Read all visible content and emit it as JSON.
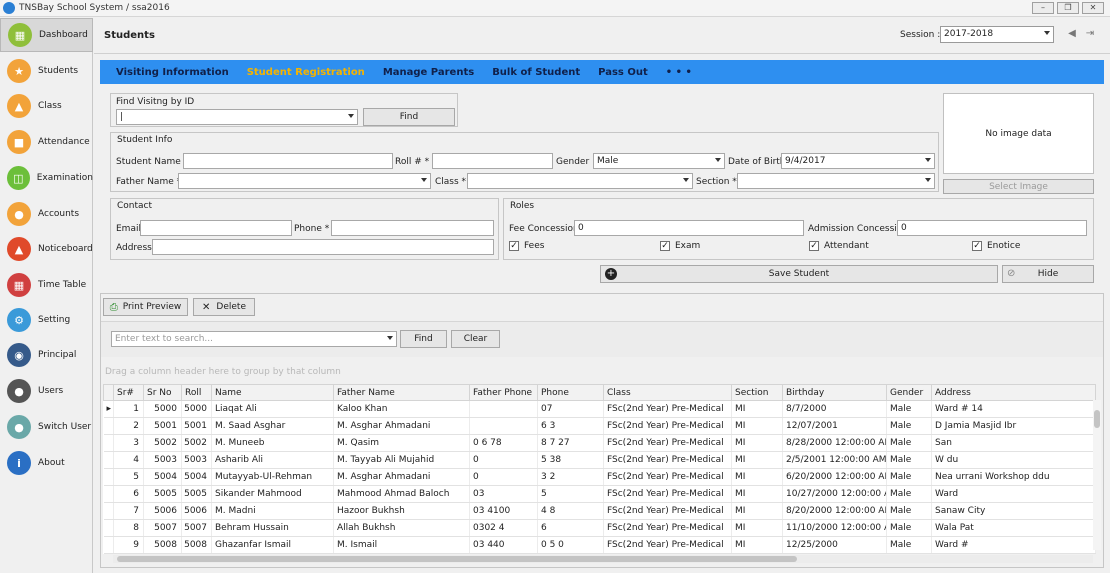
{
  "window": {
    "title": "TNSBay School System / ssa2016"
  },
  "sidebar": {
    "items": [
      {
        "label": "Dashboard",
        "icon": "dashboard-icon",
        "color": "#8fbf3a"
      },
      {
        "label": "Students",
        "icon": "graduate-icon",
        "color": "#f2a33a"
      },
      {
        "label": "Class",
        "icon": "class-icon",
        "color": "#f2a33a"
      },
      {
        "label": "Attendance",
        "icon": "attendance-icon",
        "color": "#f2a33a"
      },
      {
        "label": "Examination",
        "icon": "examination-icon",
        "color": "#6cbf3a"
      },
      {
        "label": "Accounts",
        "icon": "accounts-icon",
        "color": "#f2a33a"
      },
      {
        "label": "Noticeboard",
        "icon": "bell-icon",
        "color": "#e04a2a"
      },
      {
        "label": "Time Table",
        "icon": "calendar-icon",
        "color": "#d04040"
      },
      {
        "label": "Setting",
        "icon": "gear-icon",
        "color": "#3a9ad9"
      },
      {
        "label": "Principal",
        "icon": "eye-icon",
        "color": "#355a8a"
      },
      {
        "label": "Users",
        "icon": "user-icon",
        "color": "#555555"
      },
      {
        "label": "Switch User",
        "icon": "switch-user-icon",
        "color": "#6aa8a8"
      },
      {
        "label": "About",
        "icon": "info-icon",
        "color": "#2a6fc4"
      }
    ]
  },
  "header": {
    "title": "Students",
    "session_label": "Session :",
    "session_value": "2017-2018"
  },
  "nav": {
    "items": [
      "Visiting Information",
      "Student Registration",
      "Manage Parents",
      "Bulk of Student",
      "Pass Out",
      "• • •"
    ],
    "active_index": 1,
    "accent": "#2e8ff0"
  },
  "find_visiting": {
    "label": "Find Visitng by ID",
    "value": "|",
    "button": "Find"
  },
  "student_info": {
    "title": "Student Info",
    "student_name_label": "Student Name *",
    "student_name_value": "",
    "roll_label": "Roll # *",
    "roll_value": "",
    "gender_label": "Gender",
    "gender_value": "Male",
    "dob_label": "Date of Birth",
    "dob_value": "9/4/2017",
    "father_name_label": "Father Name *",
    "father_name_value": "",
    "class_label": "Class *",
    "class_value": "",
    "section_label": "Section *",
    "section_value": ""
  },
  "image": {
    "placeholder": "No image data",
    "select_button": "Select Image"
  },
  "contact": {
    "title": "Contact",
    "email_label": "Email",
    "email_value": "",
    "phone_label": "Phone *",
    "phone_value": "",
    "address_label": "Address",
    "address_value": ""
  },
  "roles": {
    "title": "Roles",
    "fee_concession_label": "Fee Concession",
    "fee_concession_value": "0",
    "admission_concession_label": "Admission Concession",
    "admission_concession_value": "0",
    "checks": [
      {
        "label": "Fees",
        "checked": true
      },
      {
        "label": "Exam",
        "checked": true
      },
      {
        "label": "Attendant",
        "checked": true
      },
      {
        "label": "Enotice",
        "checked": true
      }
    ]
  },
  "actions": {
    "save": "Save Student",
    "hide": "Hide"
  },
  "grid_toolbar": {
    "print_preview": "Print Preview",
    "delete": "Delete"
  },
  "grid_search": {
    "placeholder": "Enter text to search...",
    "find": "Find",
    "clear": "Clear",
    "group_hint": "Drag a column header here to group by that column"
  },
  "grid": {
    "columns": [
      "Sr#",
      "Sr No",
      "Roll",
      "Name",
      "Father Name",
      "Father Phone",
      "Phone",
      "Class",
      "Section",
      "Birthday",
      "Gender",
      "Address"
    ],
    "rows": [
      [
        "1",
        "5000",
        "5000",
        "Liaqat Ali",
        "Kaloo Khan",
        "",
        "07",
        "FSc(2nd Year) Pre-Medical",
        "MI",
        "8/7/2000",
        "Male",
        "Ward # 14"
      ],
      [
        "2",
        "5001",
        "5001",
        "M. Saad Asghar",
        "M. Asghar Ahmadani",
        "",
        "6 3",
        "FSc(2nd Year) Pre-Medical",
        "MI",
        "12/07/2001",
        "Male",
        "D Jamia Masjid Ibr"
      ],
      [
        "3",
        "5002",
        "5002",
        "M. Muneeb",
        "M. Qasim",
        "0 6 78",
        "8 7 27",
        "FSc(2nd Year) Pre-Medical",
        "MI",
        "8/28/2000 12:00:00 AM",
        "Male",
        "San"
      ],
      [
        "4",
        "5003",
        "5003",
        "Asharib Ali",
        "M. Tayyab Ali Mujahid",
        "0",
        "5 38",
        "FSc(2nd Year) Pre-Medical",
        "MI",
        "2/5/2001 12:00:00 AM",
        "Male",
        "W du"
      ],
      [
        "5",
        "5004",
        "5004",
        "Mutayyab-Ul-Rehman",
        "M. Asghar Ahmadani",
        "0",
        "3 2",
        "FSc(2nd Year) Pre-Medical",
        "MI",
        "6/20/2000 12:00:00 AM",
        "Male",
        "Nea urrani Workshop ddu"
      ],
      [
        "6",
        "5005",
        "5005",
        "Sikander Mahmood",
        "Mahmood Ahmad Baloch",
        "03",
        "5",
        "FSc(2nd Year) Pre-Medical",
        "MI",
        "10/27/2000 12:00:00 AM",
        "Male",
        "Ward"
      ],
      [
        "7",
        "5006",
        "5006",
        "M. Madni",
        "Hazoor Bukhsh",
        "03 4100",
        "4 8",
        "FSc(2nd Year) Pre-Medical",
        "MI",
        "8/20/2000 12:00:00 AM",
        "Male",
        "Sanaw City"
      ],
      [
        "8",
        "5007",
        "5007",
        "Behram Hussain",
        "Allah Bukhsh",
        "0302 4",
        "6",
        "FSc(2nd Year) Pre-Medical",
        "MI",
        "11/10/2000 12:00:00 AM",
        "Male",
        "Wala Pat"
      ],
      [
        "9",
        "5008",
        "5008",
        "Ghazanfar Ismail",
        "M. Ismail",
        "03 440",
        "0 5 0",
        "FSc(2nd Year) Pre-Medical",
        "MI",
        "12/25/2000",
        "Male",
        "Ward #"
      ]
    ]
  }
}
